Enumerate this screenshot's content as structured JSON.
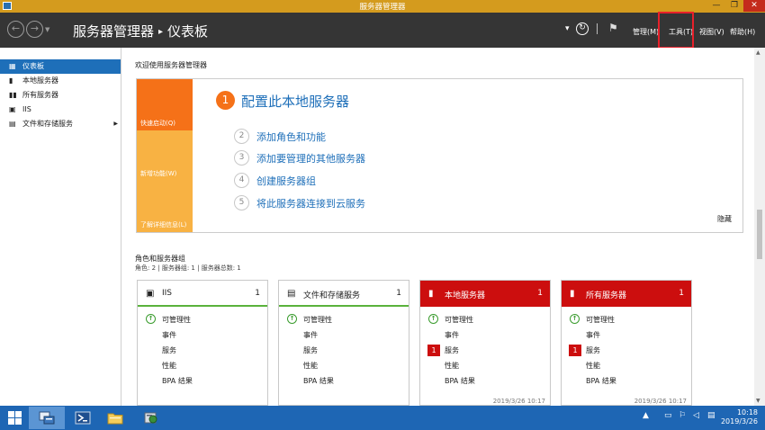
{
  "window": {
    "title": "服务器管理器",
    "min_glyph": "—",
    "max_glyph": "❐",
    "close_glyph": "✕"
  },
  "header": {
    "breadcrumb_root": "服务器管理器",
    "breadcrumb_sep": "▸",
    "breadcrumb_current": "仪表板",
    "refresh_glyph": "↻",
    "flag_glyph": "⚑",
    "menus": [
      "管理(M)",
      "工具(T)",
      "视图(V)",
      "帮助(H)"
    ]
  },
  "sidebar": {
    "items": [
      {
        "label": "仪表板",
        "icon": "dashboard-icon",
        "active": true
      },
      {
        "label": "本地服务器",
        "icon": "server-icon",
        "active": false
      },
      {
        "label": "所有服务器",
        "icon": "servers-icon",
        "active": false
      },
      {
        "label": "IIS",
        "icon": "iis-icon",
        "active": false
      },
      {
        "label": "文件和存储服务",
        "icon": "file-storage-icon",
        "active": false,
        "has_arrow": true
      }
    ]
  },
  "welcome": {
    "title": "欢迎使用服务器管理器",
    "tiles": [
      "快速启动(Q)",
      "新增功能(W)",
      "了解详细信息(L)"
    ],
    "step1_num": "1",
    "step1_label": "配置此本地服务器",
    "steps": [
      {
        "num": "2",
        "label": "添加角色和功能"
      },
      {
        "num": "3",
        "label": "添加要管理的其他服务器"
      },
      {
        "num": "4",
        "label": "创建服务器组"
      },
      {
        "num": "5",
        "label": "将此服务器连接到云服务"
      }
    ],
    "hide_label": "隐藏"
  },
  "roles": {
    "title": "角色和服务器组",
    "subtitle": "角色: 2 | 服务器组: 1 | 服务器总数: 1",
    "cards": [
      {
        "name": "IIS",
        "count": "1",
        "style": "white",
        "rows": [
          "可管理性",
          "事件",
          "服务",
          "性能",
          "BPA 结果"
        ],
        "time": ""
      },
      {
        "name": "文件和存储服务",
        "count": "1",
        "style": "white",
        "rows": [
          "可管理性",
          "事件",
          "服务",
          "性能",
          "BPA 结果"
        ],
        "time": ""
      },
      {
        "name": "本地服务器",
        "count": "1",
        "style": "red",
        "rows": [
          "可管理性",
          "事件",
          "服务",
          "性能",
          "BPA 结果"
        ],
        "services_badge": "1",
        "time": "2019/3/26 10:17"
      },
      {
        "name": "所有服务器",
        "count": "1",
        "style": "red",
        "rows": [
          "可管理性",
          "事件",
          "服务",
          "性能",
          "BPA 结果"
        ],
        "services_badge": "1",
        "time": "2019/3/26 10:17"
      }
    ]
  },
  "taskbar": {
    "clock_time": "10:18",
    "clock_date": "2019/3/26",
    "tray_expand": "▲"
  },
  "colors": {
    "titlebar": "#d49b1e",
    "header": "#353535",
    "accent_blue": "#1e6fb9",
    "quick_start": "#f57118",
    "tile_yellow": "#f8b243",
    "alert_red": "#cc0e0e",
    "ok_green": "#3a9c2e",
    "taskbar": "#1e66b4"
  }
}
